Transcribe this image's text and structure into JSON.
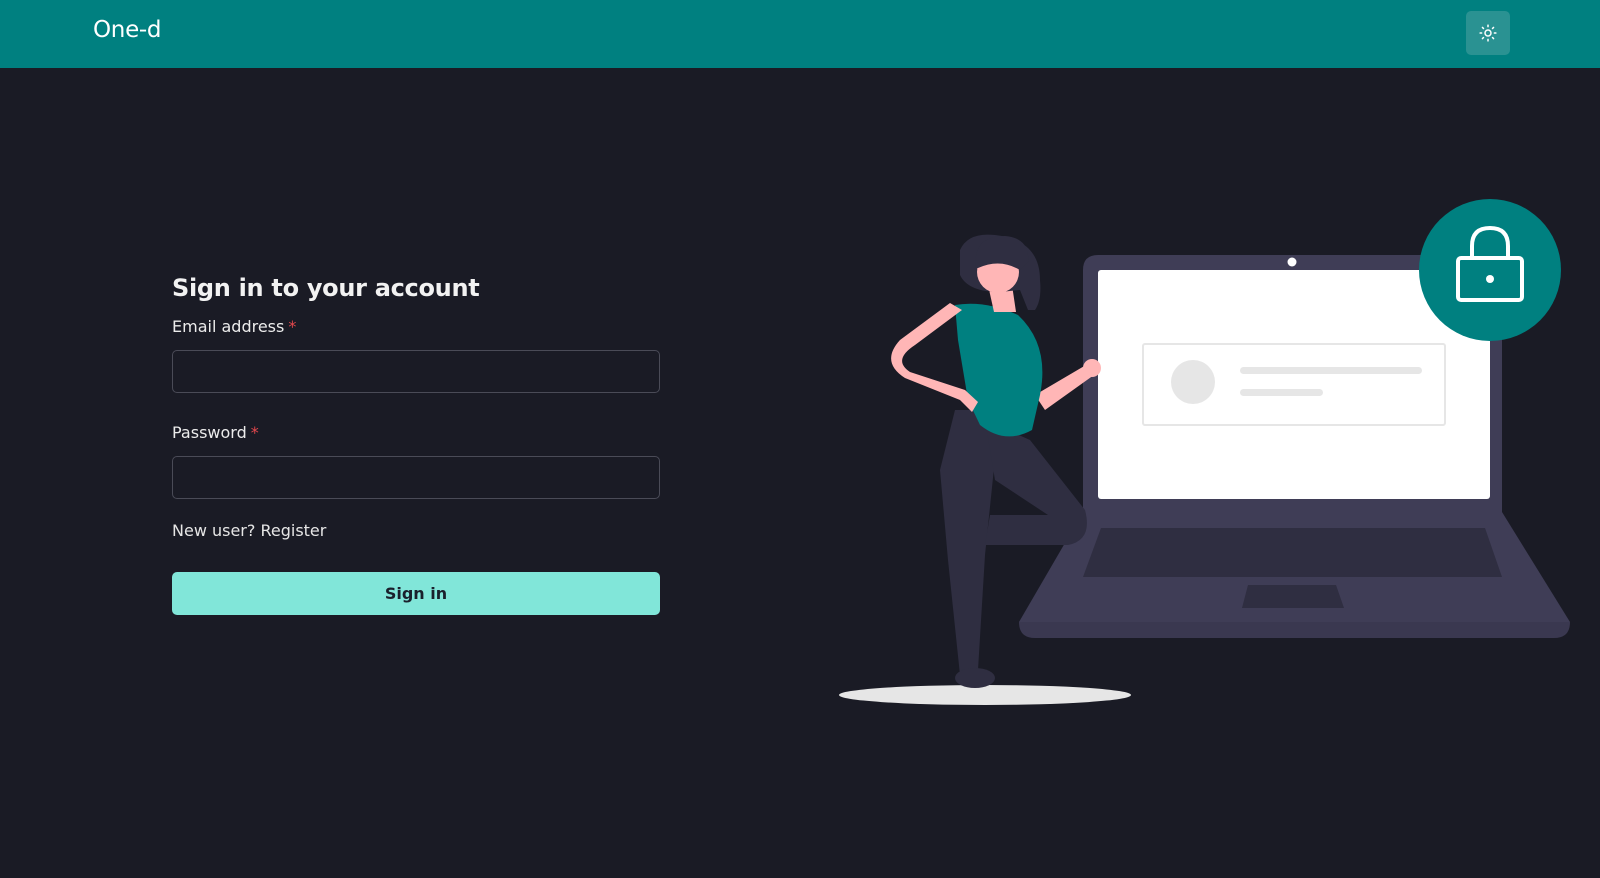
{
  "header": {
    "brand": "One-d",
    "theme_toggle_icon": "sun-icon"
  },
  "login": {
    "title": "Sign in to your account",
    "email_label": "Email address",
    "password_label": "Password",
    "required_marker": "*",
    "email_value": "",
    "password_value": "",
    "register_prompt": "New user?",
    "register_link": "Register",
    "submit_label": "Sign in"
  },
  "colors": {
    "header_bg": "#008080",
    "page_bg": "#1a1b25",
    "accent": "#81e6d9",
    "required": "#e5484d"
  },
  "illustration": {
    "icons": [
      "person-figure",
      "laptop-icon",
      "lock-icon"
    ]
  }
}
